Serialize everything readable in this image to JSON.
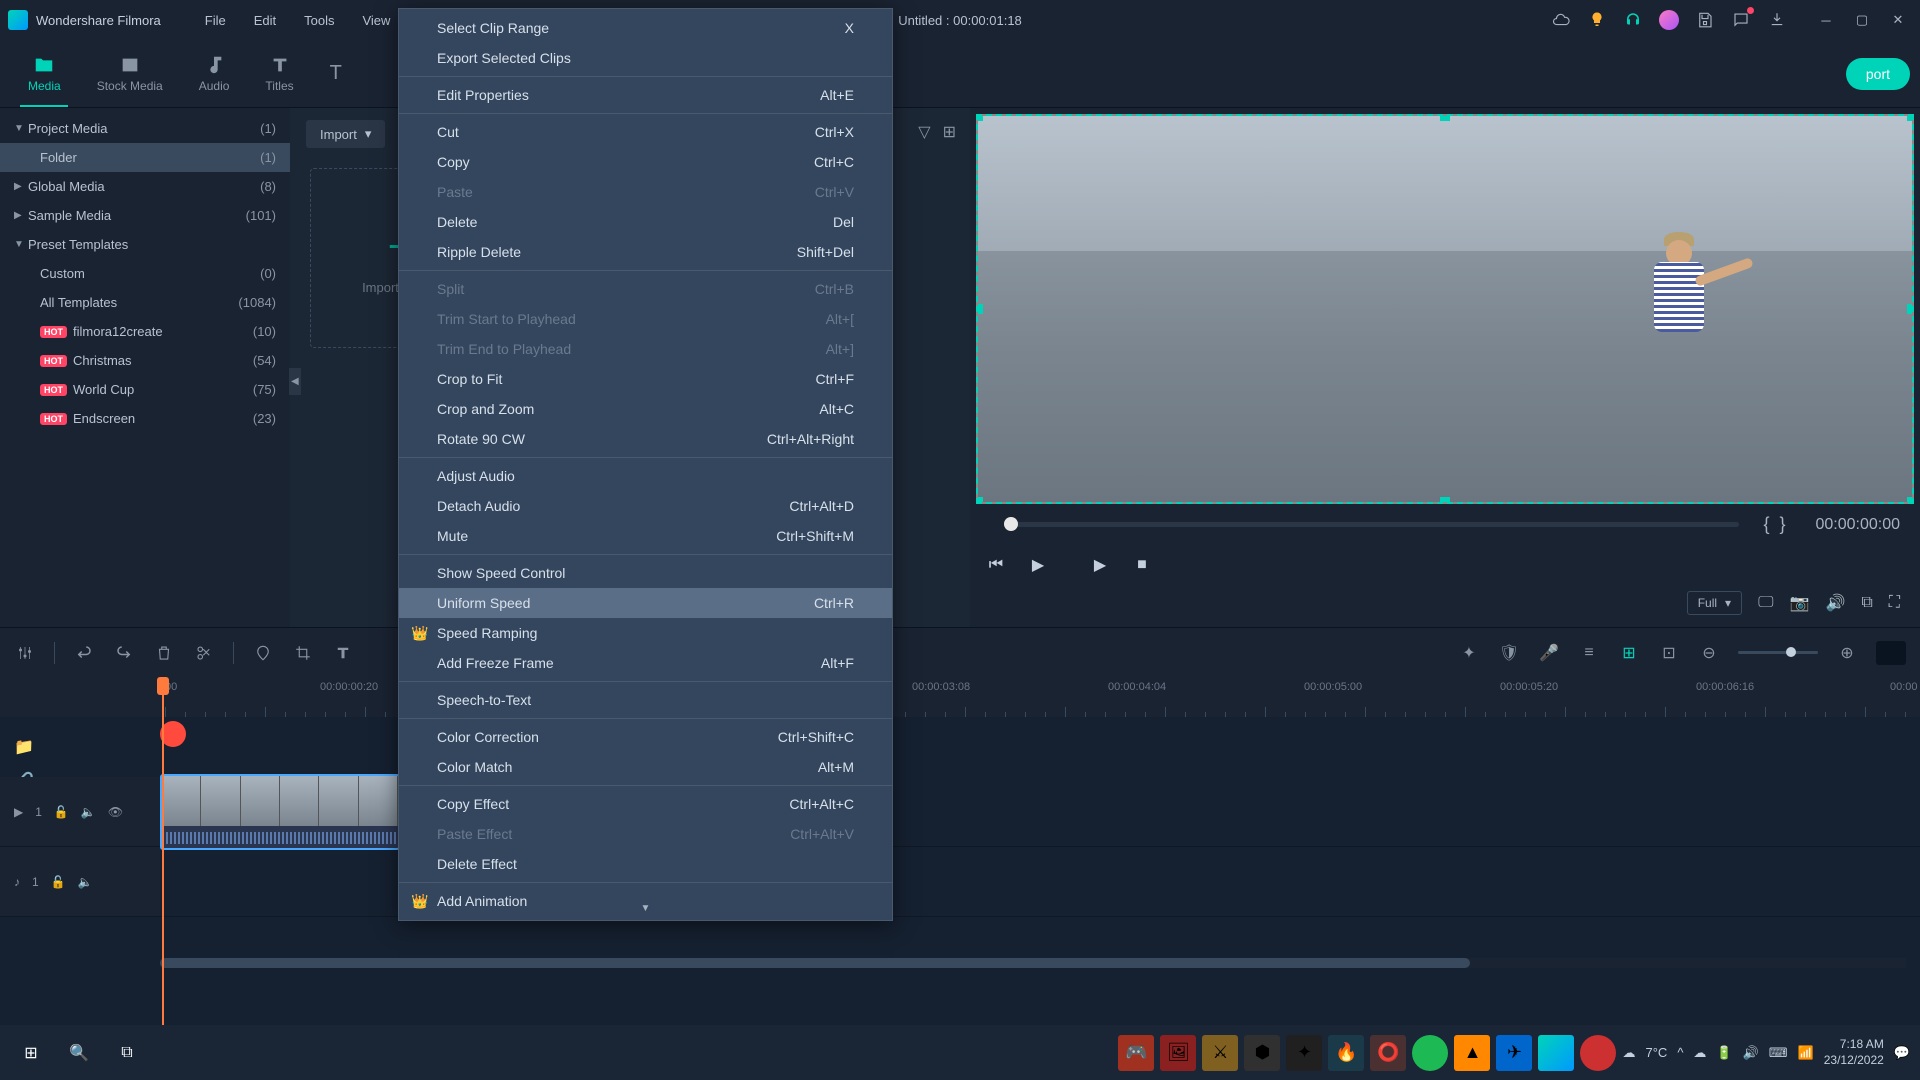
{
  "app": {
    "title": "Wondershare Filmora"
  },
  "menubar": [
    "File",
    "Edit",
    "Tools",
    "View"
  ],
  "document": {
    "title": "Untitled : 00:00:01:18"
  },
  "tabs": [
    {
      "label": "Media",
      "active": true
    },
    {
      "label": "Stock Media"
    },
    {
      "label": "Audio"
    },
    {
      "label": "Titles"
    },
    {
      "label": "T"
    }
  ],
  "export_label": "port",
  "import_label": "Import",
  "sidebar": {
    "items": [
      {
        "label": "Project Media",
        "count": "(1)",
        "chevron": "▼"
      },
      {
        "label": "Folder",
        "count": "(1)",
        "sub": true,
        "selected": true
      },
      {
        "label": "Global Media",
        "count": "(8)",
        "chevron": "▶"
      },
      {
        "label": "Sample Media",
        "count": "(101)",
        "chevron": "▶"
      },
      {
        "label": "Preset Templates",
        "count": "",
        "chevron": "▼"
      },
      {
        "label": "Custom",
        "count": "(0)",
        "sub": true
      },
      {
        "label": "All Templates",
        "count": "(1084)",
        "sub": true
      },
      {
        "label": "filmora12create",
        "count": "(10)",
        "sub": true,
        "hot": true
      },
      {
        "label": "Christmas",
        "count": "(54)",
        "sub": true,
        "hot": true
      },
      {
        "label": "World Cup",
        "count": "(75)",
        "sub": true,
        "hot": true
      },
      {
        "label": "Endscreen",
        "count": "(23)",
        "sub": true,
        "hot": true
      }
    ]
  },
  "import_drop": "Import Media",
  "context_menu": [
    {
      "label": "Select Clip Range",
      "shortcut": "X"
    },
    {
      "label": "Export Selected Clips"
    },
    {
      "sep": true
    },
    {
      "label": "Edit Properties",
      "shortcut": "Alt+E"
    },
    {
      "sep": true
    },
    {
      "label": "Cut",
      "shortcut": "Ctrl+X"
    },
    {
      "label": "Copy",
      "shortcut": "Ctrl+C"
    },
    {
      "label": "Paste",
      "shortcut": "Ctrl+V",
      "disabled": true
    },
    {
      "label": "Delete",
      "shortcut": "Del"
    },
    {
      "label": "Ripple Delete",
      "shortcut": "Shift+Del"
    },
    {
      "sep": true
    },
    {
      "label": "Split",
      "shortcut": "Ctrl+B",
      "disabled": true
    },
    {
      "label": "Trim Start to Playhead",
      "shortcut": "Alt+[",
      "disabled": true
    },
    {
      "label": "Trim End to Playhead",
      "shortcut": "Alt+]",
      "disabled": true
    },
    {
      "label": "Crop to Fit",
      "shortcut": "Ctrl+F"
    },
    {
      "label": "Crop and Zoom",
      "shortcut": "Alt+C"
    },
    {
      "label": "Rotate 90 CW",
      "shortcut": "Ctrl+Alt+Right"
    },
    {
      "sep": true
    },
    {
      "label": "Adjust Audio"
    },
    {
      "label": "Detach Audio",
      "shortcut": "Ctrl+Alt+D"
    },
    {
      "label": "Mute",
      "shortcut": "Ctrl+Shift+M"
    },
    {
      "sep": true
    },
    {
      "label": "Show Speed Control"
    },
    {
      "label": "Uniform Speed",
      "shortcut": "Ctrl+R",
      "highlighted": true
    },
    {
      "label": "Speed Ramping",
      "crown": true
    },
    {
      "label": "Add Freeze Frame",
      "shortcut": "Alt+F"
    },
    {
      "sep": true
    },
    {
      "label": "Speech-to-Text"
    },
    {
      "sep": true
    },
    {
      "label": "Color Correction",
      "shortcut": "Ctrl+Shift+C"
    },
    {
      "label": "Color Match",
      "shortcut": "Alt+M"
    },
    {
      "sep": true
    },
    {
      "label": "Copy Effect",
      "shortcut": "Ctrl+Alt+C"
    },
    {
      "label": "Paste Effect",
      "shortcut": "Ctrl+Alt+V",
      "disabled": true
    },
    {
      "label": "Delete Effect"
    },
    {
      "sep": true
    },
    {
      "label": "Add Animation",
      "crown": true
    }
  ],
  "preview": {
    "timecode_end": "00:00:00:00",
    "quality": "Full",
    "brace_open": "{",
    "brace_close": "}"
  },
  "ruler": [
    "00",
    "00:00:00:20",
    "00:00:03:08",
    "00:00:04:04",
    "00:00:05:00",
    "00:00:05:20",
    "00:00:06:16",
    "00:00"
  ],
  "ruler_pos": [
    165,
    320,
    912,
    1108,
    1304,
    1500,
    1696,
    1890
  ],
  "tracks": {
    "video": {
      "num": "1"
    },
    "audio": {
      "num": "1"
    }
  },
  "taskbar": {
    "weather": "7°C",
    "time": "7:18 AM",
    "date": "23/12/2022"
  }
}
